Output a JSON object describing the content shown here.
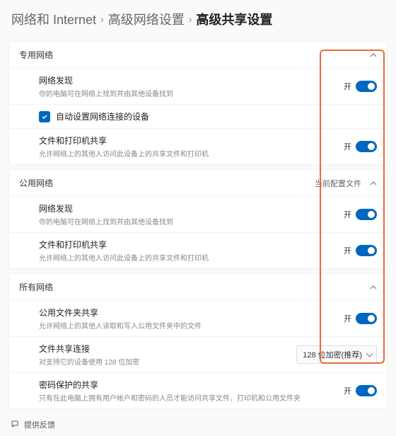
{
  "breadcrumb": {
    "l1": "网络和 Internet",
    "sep": "›",
    "l2": "高级网络设置",
    "current": "高级共享设置"
  },
  "sections": {
    "private": {
      "title": "专用网络",
      "network_discovery": {
        "title": "网络发现",
        "desc": "你的电脑可在网络上找到并由其他设备找到",
        "state": "开"
      },
      "auto_setup": {
        "label": "自动设置网络连接的设备"
      },
      "file_printer": {
        "title": "文件和打印机共享",
        "desc": "允许网络上的其他人访问此设备上的共享文件和打印机",
        "state": "开"
      }
    },
    "public": {
      "title": "公用网络",
      "tag": "当前配置文件",
      "network_discovery": {
        "title": "网络发现",
        "desc": "你的电脑可在网络上找到并由其他设备找到",
        "state": "开"
      },
      "file_printer": {
        "title": "文件和打印机共享",
        "desc": "允许网络上的其他人访问此设备上的共享文件和打印机",
        "state": "开"
      }
    },
    "all": {
      "title": "所有网络",
      "public_folder": {
        "title": "公用文件夹共享",
        "desc": "允许网络上的其他人读取和写入公用文件夹中的文件",
        "state": "开"
      },
      "file_conn": {
        "title": "文件共享连接",
        "desc": "对支持它的设备使用 128 位加密",
        "dropdown": "128 位加密(推荐)"
      },
      "password": {
        "title": "密码保护的共享",
        "desc": "只有在此电脑上拥有用户帐户和密码的人员才能访问共享文件、打印机和公用文件夹",
        "state": "开"
      }
    }
  },
  "feedback": "提供反馈"
}
